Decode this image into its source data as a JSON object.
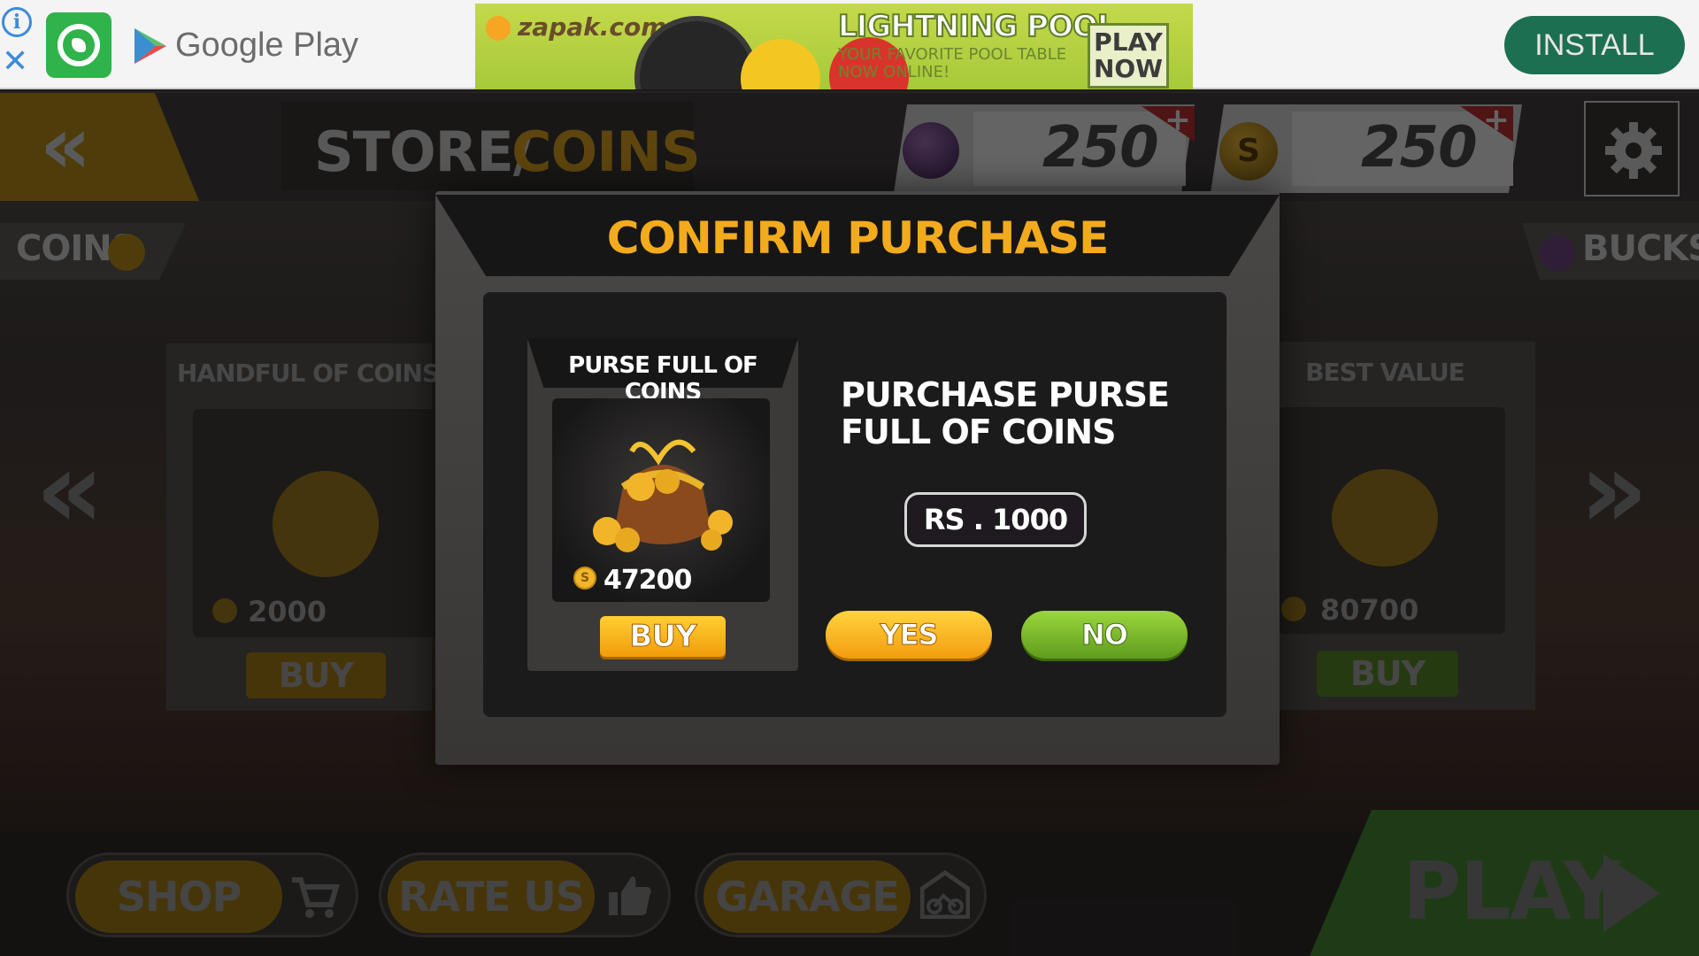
{
  "ad": {
    "info_glyph": "i",
    "close_glyph": "✕",
    "store_name": "Google Play",
    "creative": {
      "brand": "zapak.com",
      "headline": "LIGHTNING POOL",
      "tagline_1": "YOUR FAVORITE POOL TABLE",
      "tagline_2": "NOW ONLINE!",
      "cta_1": "PLAY",
      "cta_2": "NOW"
    },
    "install_label": "INSTALL",
    "colors": {
      "install_bg": "#1d6f51",
      "whatsapp": "#2fb34a"
    }
  },
  "header": {
    "back_glyph": "«",
    "title_prefix": "STORE/",
    "title_suffix": "COINS",
    "gems": {
      "value": "250",
      "plus": "+"
    },
    "coins": {
      "value": "250",
      "plus": "+",
      "symbol": "S"
    },
    "settings_icon": "gear-icon"
  },
  "tabs": {
    "coins_label": "COINS",
    "bucks_label": "BUCKS"
  },
  "store_cards": [
    {
      "title": "HANDFUL OF COINS",
      "value": "2000",
      "buy": "BUY"
    },
    {
      "title": "BEST VALUE",
      "value": "80700",
      "buy": "BUY"
    }
  ],
  "nav": {
    "left_glyph": "«",
    "right_glyph": "»"
  },
  "bottom_bar": {
    "shop_label": "SHOP",
    "rate_label": "RATE US",
    "garage_label": "GARAGE",
    "play_label": "PLAY"
  },
  "modal": {
    "title": "CONFIRM PURCHASE",
    "item_name": "PURSE FULL OF COINS",
    "item_coin_symbol": "S",
    "item_amount": "47200",
    "item_buy": "BUY",
    "message": "PURCHASE PURSE FULL OF COINS",
    "price": "RS . 1000",
    "yes_label": "YES",
    "no_label": "NO",
    "colors": {
      "title": "#f3ab1e",
      "yes": "#f7b522",
      "no": "#7ec22e"
    }
  }
}
